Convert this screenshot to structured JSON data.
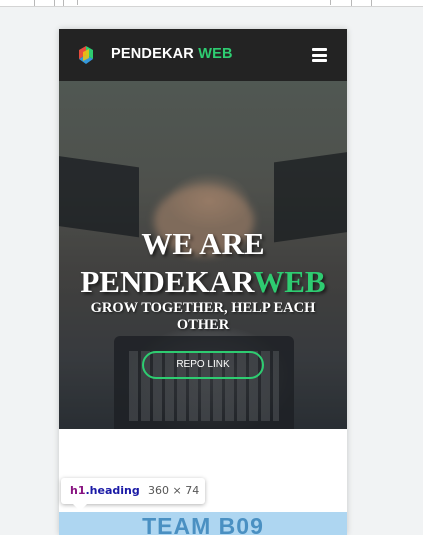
{
  "navbar": {
    "brand_main": "PENDEKAR",
    "brand_accent": "WEB"
  },
  "hero": {
    "title_line1": "WE ARE",
    "title_line2_main": "PENDEKAR",
    "title_line2_accent": "WEB",
    "subtitle": "GROW TOGETHER, HELP EACH OTHER",
    "button_label": "REPO LINK"
  },
  "team": {
    "title": "TEAM B09"
  },
  "inspector_tooltip": {
    "tag": "h1",
    "class": ".heading",
    "size": "360 × 74"
  },
  "colors": {
    "accent": "#2ecc71",
    "navbar_bg": "#232323",
    "team_band": "#aed6f1"
  },
  "icons": [
    "logo-icon",
    "hamburger-icon"
  ]
}
